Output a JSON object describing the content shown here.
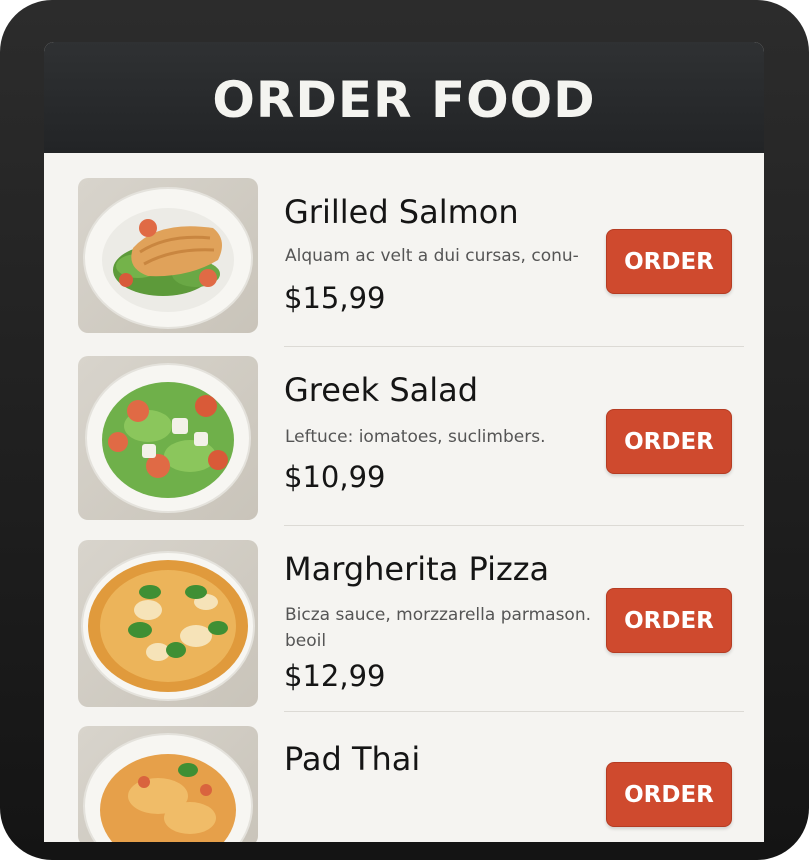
{
  "header": {
    "title": "ORDER FOOD"
  },
  "menu": {
    "items": [
      {
        "name": "Grilled Salmon",
        "description": "Alquam ac velt a dui cursas, conu-",
        "price": "$15,99",
        "order_label": "ORDER",
        "image_icon": "grilled-salmon-image"
      },
      {
        "name": "Greek Salad",
        "description": "Leftuce: iomatoes, suclimbers.",
        "price": "$10,99",
        "order_label": "ORDER",
        "image_icon": "greek-salad-image"
      },
      {
        "name": "Margherita Pizza",
        "description": "Bicza sauce, morzzarella parmason. beoil",
        "price": "$12,99",
        "order_label": "ORDER",
        "image_icon": "margherita-pizza-image"
      },
      {
        "name": "Pad Thai",
        "order_label": "ORDER",
        "image_icon": "pad-thai-image"
      }
    ]
  },
  "colors": {
    "header_bg": "#2a2c2e",
    "button_bg": "#cf4a2e",
    "screen_bg": "#f5f4f1"
  }
}
